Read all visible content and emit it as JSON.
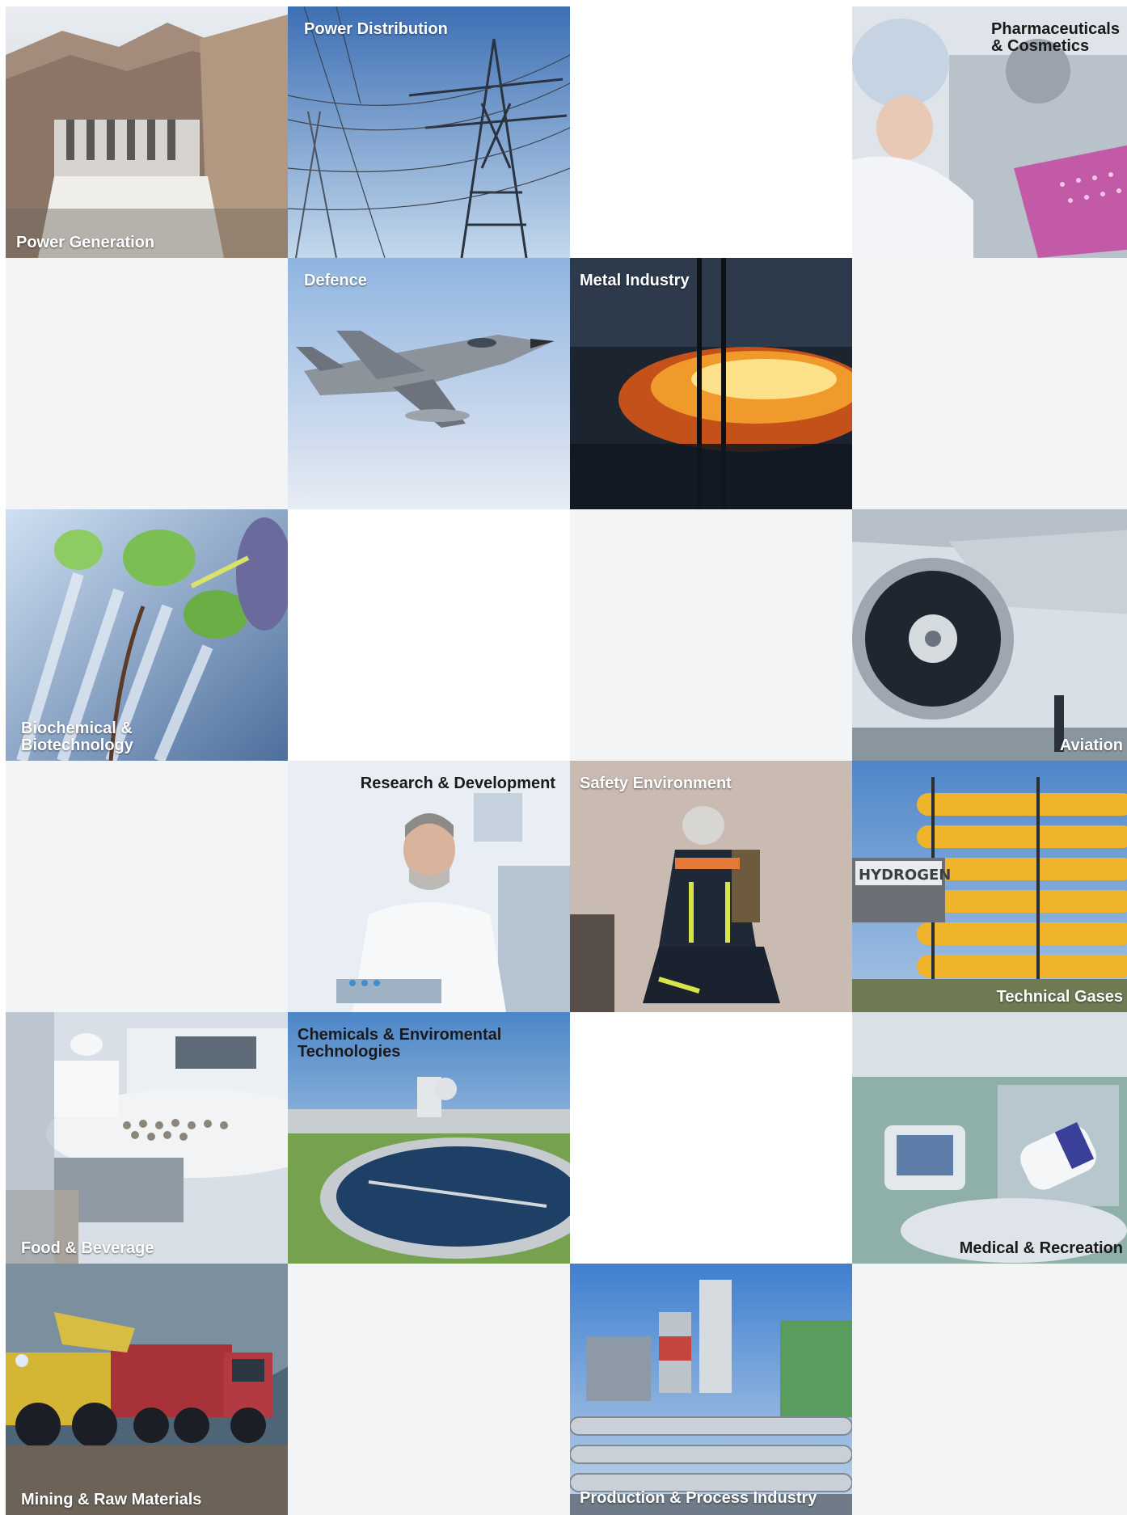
{
  "tiles": {
    "power_generation": "Power Generation",
    "power_distribution": "Power Distribution",
    "pharmaceuticals": "Pharmaceuticals\n& Cosmetics",
    "defence": "Defence",
    "metal_industry": "Metal Industry",
    "biochemical": "Biochemical &\nBiotechnology",
    "aviation": "Aviation",
    "research": "Research & Development",
    "safety": "Safety Environment",
    "technical_gases": "Technical Gases",
    "hydrogen_sign": "HYDROGEN",
    "food": "Food & Beverage",
    "chemicals": "Chemicals & Enviromental\nTechnologies",
    "medical": "Medical & Recreation",
    "mining": "Mining & Raw Materials",
    "production": "Production & Process Industry"
  },
  "colors": {
    "empty_light": "#f3f4f6",
    "empty_white": "#ffffff",
    "label_text": "#ffffff"
  }
}
